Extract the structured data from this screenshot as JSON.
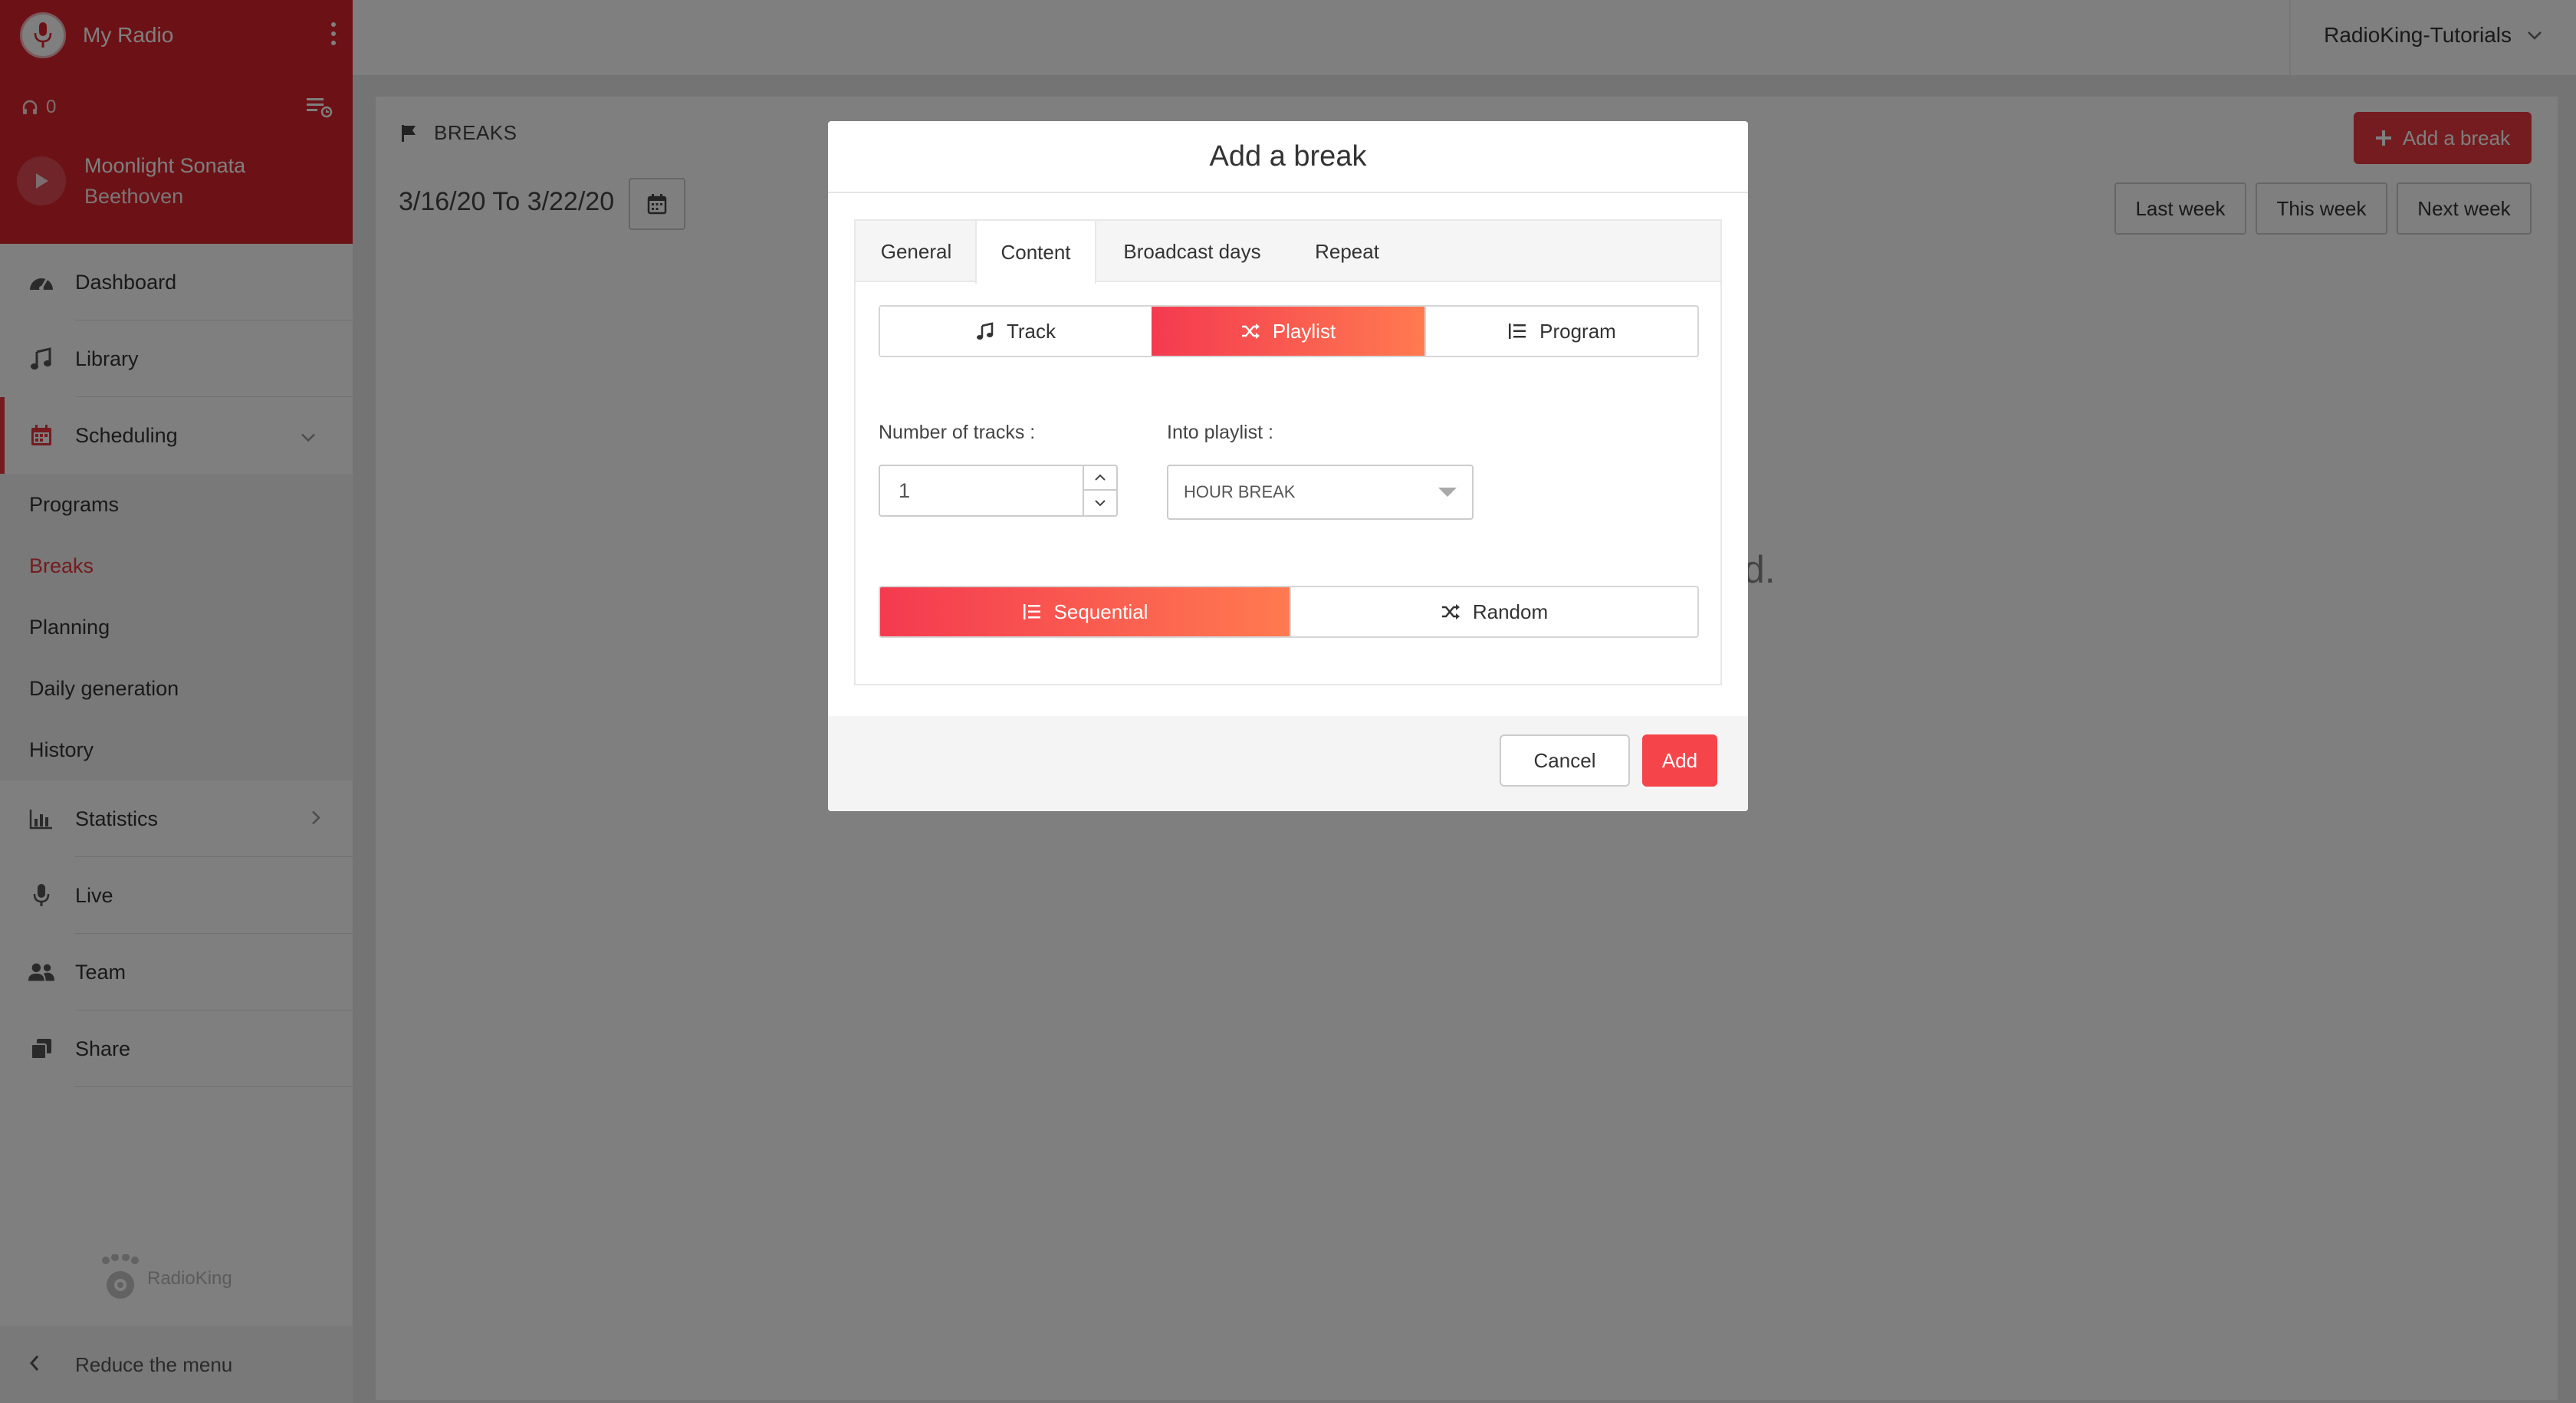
{
  "sidebar": {
    "radio_name": "My Radio",
    "listeners": "0",
    "now_playing": {
      "title": "Moonlight Sonata",
      "artist": "Beethoven"
    },
    "nav": [
      {
        "label": "Dashboard",
        "icon": "gauge-icon"
      },
      {
        "label": "Library",
        "icon": "music-note-icon"
      },
      {
        "label": "Scheduling",
        "icon": "calendar-icon",
        "active": true,
        "expanded": true
      },
      {
        "label": "Statistics",
        "icon": "bar-chart-icon"
      },
      {
        "label": "Live",
        "icon": "microphone-icon"
      },
      {
        "label": "Team",
        "icon": "users-icon"
      },
      {
        "label": "Share",
        "icon": "share-icon"
      }
    ],
    "sub_nav": [
      {
        "label": "Programs"
      },
      {
        "label": "Breaks",
        "active": true
      },
      {
        "label": "Planning"
      },
      {
        "label": "Daily generation"
      },
      {
        "label": "History"
      }
    ],
    "brand_logo_text": "RadioKing",
    "reduce_label": "Reduce the menu"
  },
  "topbar": {
    "account_name": "RadioKing-Tutorials"
  },
  "page": {
    "section_label": "BREAKS",
    "date_from": "3/16/20",
    "date_to_word": "To",
    "date_to": "3/22/20",
    "add_break_label": "Add a break",
    "week_buttons": [
      "Last week",
      "This week",
      "Next week"
    ],
    "empty_hint_visible_fragment": "d."
  },
  "modal": {
    "title": "Add a break",
    "tabs": [
      "General",
      "Content",
      "Broadcast days",
      "Repeat"
    ],
    "active_tab": "Content",
    "content_types": [
      "Track",
      "Playlist",
      "Program"
    ],
    "active_content_type": "Playlist",
    "number_of_tracks": {
      "label": "Number of tracks :",
      "value": "1"
    },
    "into_playlist": {
      "label": "Into playlist :",
      "selected": "HOUR BREAK"
    },
    "order_modes": [
      "Sequential",
      "Random"
    ],
    "active_order_mode": "Sequential",
    "cancel_label": "Cancel",
    "add_label": "Add"
  },
  "colors": {
    "accent": "#e8383f",
    "header_red": "#d8242c",
    "gradient_start": "#f43a50",
    "gradient_end": "#ff7a50"
  }
}
